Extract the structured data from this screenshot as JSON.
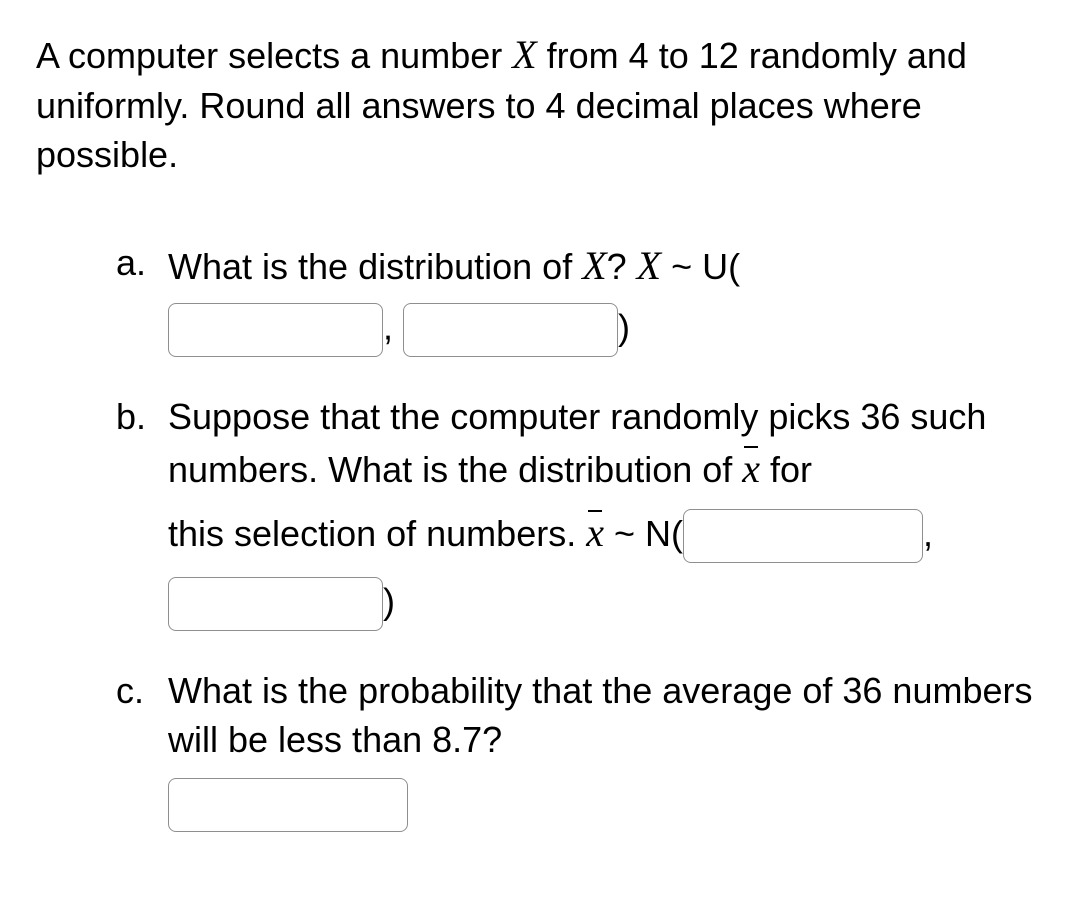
{
  "intro": {
    "pre": "A computer selects a number ",
    "var": "X",
    "mid": " from 4 to 12 randomly and uniformly. Round all answers to 4 decimal places where possible."
  },
  "a": {
    "marker": "a.",
    "pre": "What is the distribution of ",
    "var": "X",
    "q": "? ",
    "var2": "X",
    "tilde": " ~ ",
    "dist": "U(",
    "comma": ",",
    "close": ")"
  },
  "b": {
    "marker": "b.",
    "line1": "Suppose that the computer randomly picks 36 such numbers.  What is the distribution of ",
    "xbar": "x",
    "line1_end": " for",
    "line2_pre": "this selection of numbers. ",
    "xbar2": "x",
    "tilde": " ~ ",
    "dist": "N(",
    "comma": ",",
    "close": ")"
  },
  "c": {
    "marker": "c.",
    "text": "What is the probability that the average of 36 numbers will be less than 8.7?"
  }
}
